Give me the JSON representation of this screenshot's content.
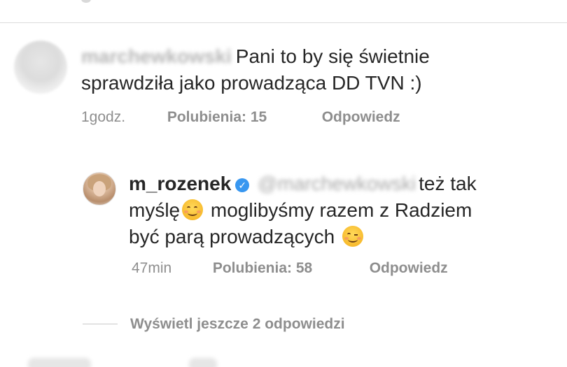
{
  "comment": {
    "username_blurred": "marchewkowski",
    "text_line1": "Pani to by się świetnie",
    "text_line2": "sprawdziła jako prowadząca DD TVN :)",
    "time": "1godz.",
    "likes": "Polubienia: 15",
    "reply": "Odpowiedz"
  },
  "reply": {
    "username": "m_rozenek",
    "mention_blurred": "@marchewkowski",
    "text_part1": "też tak",
    "text_part2": "myślę",
    "text_part3": "moglibyśmy razem z Radziem",
    "text_part4": "być parą prowadzących",
    "time": "47min",
    "likes": "Polubienia: 58",
    "reply": "Odpowiedz"
  },
  "view_more": "Wyświetl jeszcze 2 odpowiedzi",
  "icons": {
    "verified": "verified-badge-icon",
    "smile": "smiling-face-emoji",
    "wink": "winking-face-emoji"
  },
  "colors": {
    "text": "#262626",
    "meta": "#8e8e8e",
    "verified": "#3897f0",
    "divider": "#dbdbdb"
  }
}
